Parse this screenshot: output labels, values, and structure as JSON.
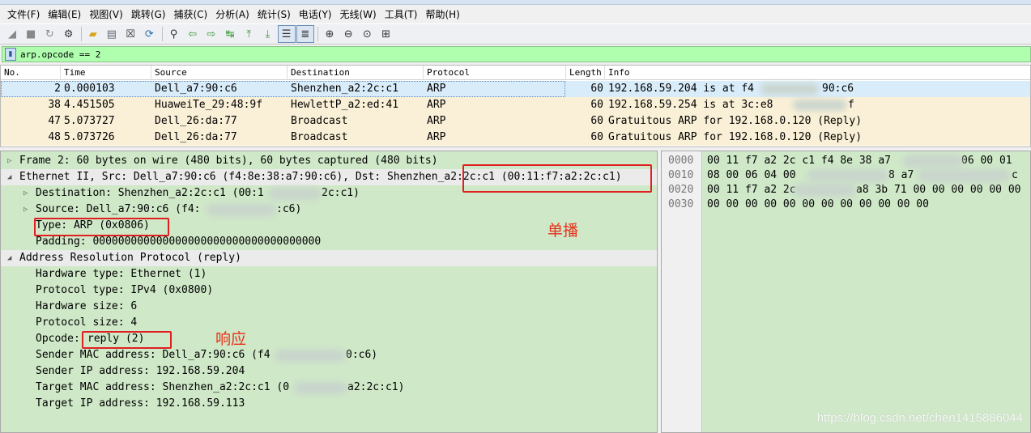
{
  "menu": [
    "文件(F)",
    "编辑(E)",
    "视图(V)",
    "跳转(G)",
    "捕获(C)",
    "分析(A)",
    "统计(S)",
    "电话(Y)",
    "无线(W)",
    "工具(T)",
    "帮助(H)"
  ],
  "toolbar_icons": [
    "shark-fin-icon",
    "stop-icon",
    "restart-icon",
    "options-gear-icon",
    "open-folder-icon",
    "save-file-icon",
    "close-file-icon",
    "reload-icon",
    "find-packet-icon",
    "back-arrow-icon",
    "forward-arrow-icon",
    "go-to-packet-icon",
    "first-packet-icon",
    "last-packet-icon",
    "auto-scroll-icon",
    "colorize-icon",
    "zoom-in-icon",
    "zoom-out-icon",
    "normal-size-icon",
    "resize-columns-icon"
  ],
  "filter": {
    "value": "arp.opcode == 2"
  },
  "packet_list": {
    "columns": [
      "No.",
      "Time",
      "Source",
      "Destination",
      "Protocol",
      "Length",
      "Info"
    ],
    "rows": [
      {
        "no": "2",
        "time": "0.000103",
        "src": "Dell_a7:90:c6",
        "dst": "Shenzhen_a2:2c:c1",
        "proto": "ARP",
        "len": "60",
        "info_a": "192.168.59.204 is at f4",
        "info_b": "90:c6"
      },
      {
        "no": "38",
        "time": "4.451505",
        "src": "HuaweiTe_29:48:9f",
        "dst": "HewlettP_a2:ed:41",
        "proto": "ARP",
        "len": "60",
        "info_a": "192.168.59.254 is at 3c:e8",
        "info_b": "f"
      },
      {
        "no": "47",
        "time": "5.073727",
        "src": "Dell_26:da:77",
        "dst": "Broadcast",
        "proto": "ARP",
        "len": "60",
        "info_a": "Gratuitous ARP for 192.168.0.120 (Reply)",
        "info_b": ""
      },
      {
        "no": "48",
        "time": "5.073726",
        "src": "Dell_26:da:77",
        "dst": "Broadcast",
        "proto": "ARP",
        "len": "60",
        "info_a": "Gratuitous ARP for 192.168.0.120 (Reply)",
        "info_b": ""
      }
    ]
  },
  "details": {
    "frame": "Frame 2: 60 bytes on wire (480 bits), 60 bytes captured (480 bits)",
    "eth": "Ethernet II, Src: Dell_a7:90:c6 (f4:8e:38:a7:90:c6), Dst: Shenzhen_a2:2c:c1 (00:11:f7:a2:2c:c1)",
    "eth_dst_a": "Destination: Shenzhen_a2:2c:c1 (00:1",
    "eth_dst_b": "2c:c1)",
    "eth_src_a": "Source: Dell_a7:90:c6 (f4:",
    "eth_src_b": ":c6)",
    "eth_type": "Type: ARP (0x0806)",
    "eth_padding": "Padding: 000000000000000000000000000000000000",
    "arp": "Address Resolution Protocol (reply)",
    "hw_type": "Hardware type: Ethernet (1)",
    "proto_type": "Protocol type: IPv4 (0x0800)",
    "hw_size": "Hardware size: 6",
    "proto_size": "Protocol size: 4",
    "opcode_label": "Opcode:",
    "opcode_value": "reply (2)",
    "sender_mac_a": "Sender MAC address: Dell_a7:90:c6 (f4",
    "sender_mac_b": "0:c6)",
    "sender_ip": "Sender IP address: 192.168.59.204",
    "target_mac_a": "Target MAC address: Shenzhen_a2:2c:c1 (0",
    "target_mac_b": "a2:2c:c1)",
    "target_ip": "Target IP address: 192.168.59.113"
  },
  "bytes": {
    "offsets": [
      "0000",
      "0010",
      "0020",
      "0030"
    ],
    "line0_a": "00 11 f7 a2 2c c1 f4 8e  38 a7",
    "line0_b": "06 00 01",
    "line1_a": "08 00 06 04 00",
    "line1_b": "8 a7",
    "line1_c": "c",
    "line2_a": "00 11 f7 a2 2c",
    "line2_b": "a8  3b 71 00 00 00 00 00 00",
    "line3": "00 00 00 00 00 00 00 00  00 00 00 00"
  },
  "annotations": {
    "unicast": "单播",
    "response": "响应"
  },
  "watermark": "https://blog.csdn.net/chen1415886044"
}
